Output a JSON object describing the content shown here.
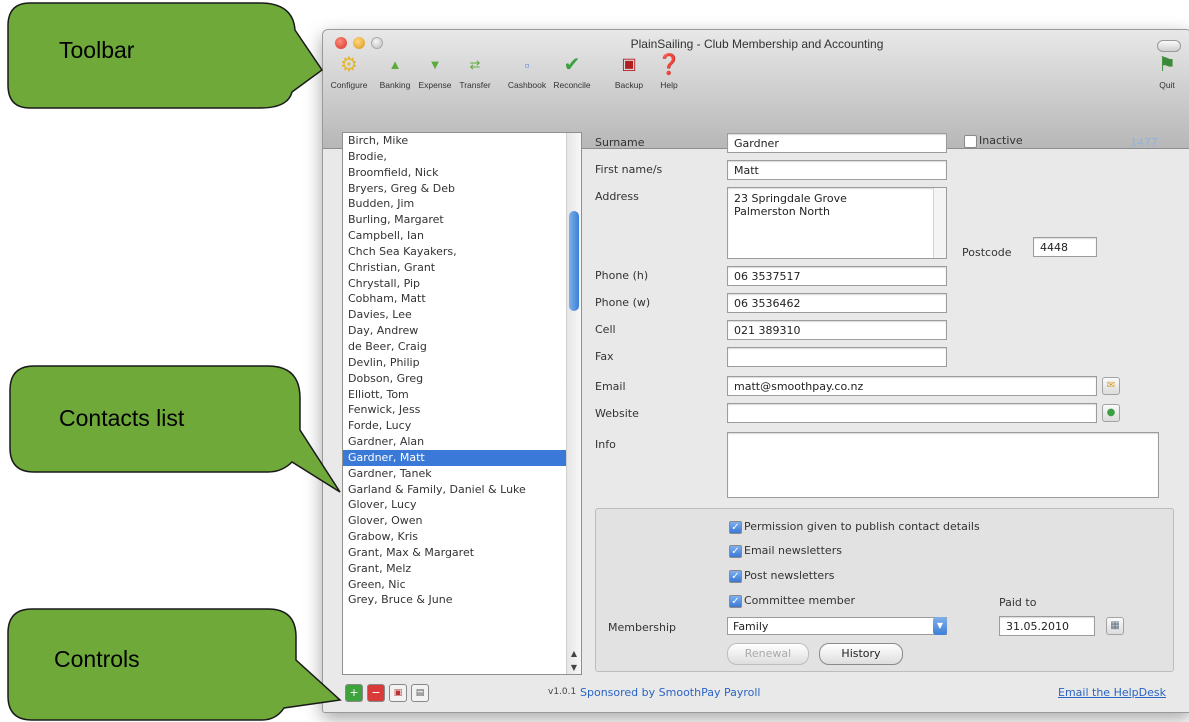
{
  "window": {
    "title": "PlainSailing - Club Membership and Accounting"
  },
  "toolbar": {
    "configure": "Configure",
    "banking": "Banking",
    "expense": "Expense",
    "transfer": "Transfer",
    "cashbook": "Cashbook",
    "reconcile": "Reconcile",
    "backup": "Backup",
    "help": "Help",
    "quit": "Quit"
  },
  "contacts": [
    "Birch, Mike",
    "Brodie,",
    "Broomfield, Nick",
    "Bryers, Greg & Deb",
    "Budden, Jim",
    "Burling, Margaret",
    "Campbell, Ian",
    "Chch Sea Kayakers,",
    "Christian, Grant",
    "Chrystall, Pip",
    "Cobham, Matt",
    "Davies, Lee",
    "Day, Andrew",
    "de Beer, Craig",
    "Devlin, Philip",
    "Dobson, Greg",
    "Elliott, Tom",
    "Fenwick, Jess",
    "Forde, Lucy",
    "Gardner, Alan",
    "Gardner, Matt",
    "Gardner, Tanek",
    "Garland & Family, Daniel & Luke",
    "Glover, Lucy",
    "Glover, Owen",
    "Grabow, Kris",
    "Grant, Max & Margaret",
    "Grant, Melz",
    "Green, Nic",
    "Grey, Bruce & June"
  ],
  "selected_contact": "Gardner, Matt",
  "form": {
    "surname_label": "Surname",
    "surname": "Gardner",
    "firstname_label": "First name/s",
    "firstname": "Matt",
    "address_label": "Address",
    "address_line1": "23 Springdale Grove",
    "address_line2": "Palmerston North",
    "inactive_label": "Inactive",
    "record_id": "1477",
    "postcode_label": "Postcode",
    "postcode": "4448",
    "phone_h_label": "Phone (h)",
    "phone_h": "06 3537517",
    "phone_w_label": "Phone (w)",
    "phone_w": "06 3536462",
    "cell_label": "Cell",
    "cell": "021 389310",
    "fax_label": "Fax",
    "fax": "",
    "email_label": "Email",
    "email": "matt@smoothpay.co.nz",
    "website_label": "Website",
    "website": "",
    "info_label": "Info",
    "info": ""
  },
  "options": {
    "permission": "Permission given to publish contact details",
    "email_newsletters": "Email newsletters",
    "post_newsletters": "Post newsletters",
    "committee": "Committee member"
  },
  "membership": {
    "label": "Membership",
    "type": "Family",
    "paid_to_label": "Paid to",
    "paid_to": "31.05.2010",
    "renewal": "Renewal",
    "history": "History"
  },
  "footer": {
    "version": "v1.0.1",
    "sponsor": "Sponsored by SmoothPay Payroll",
    "helpdesk": "Email the HelpDesk"
  },
  "callouts": {
    "toolbar": "Toolbar",
    "contacts": "Contacts list",
    "controls": "Controls"
  },
  "colors": {
    "callout_fill": "#6ea93a",
    "selection": "#3a79d7",
    "link": "#2a64c5"
  }
}
